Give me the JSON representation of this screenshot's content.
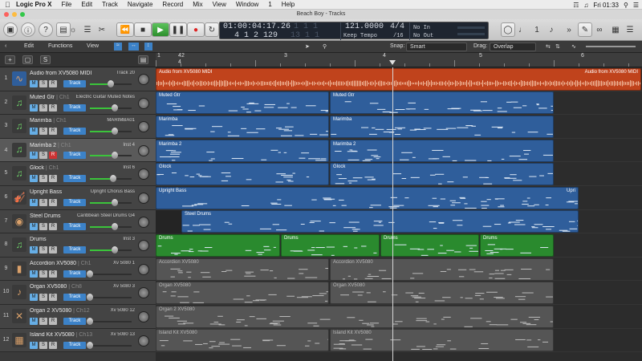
{
  "menubar": {
    "items": [
      "Logic Pro X",
      "File",
      "Edit",
      "Track",
      "Navigate",
      "Record",
      "Mix",
      "View",
      "Window",
      "1",
      "Help"
    ],
    "clock": "Fri 01:33"
  },
  "window": {
    "title": "Beach Boy - Tracks"
  },
  "lcd": {
    "smpte": "01:00:04:17.26",
    "bars": "4  1  2  129",
    "smpte_dim": "1  1  1",
    "bars_dim": "13  1  1",
    "tempo": "121.0000",
    "tempo_mode": "Keep Tempo",
    "signature": "4/4",
    "division": "/16",
    "in": "No In",
    "out": "No Out"
  },
  "edit_toolbar": {
    "edit": "Edit",
    "functions": "Functions",
    "view": "View",
    "snap_label": "Snap:",
    "snap_value": "Smart",
    "drag_label": "Drag:",
    "drag_value": "Overlap"
  },
  "ruler": {
    "marks": [
      "1",
      "2",
      "3",
      "4",
      "5",
      "6"
    ],
    "sub": [
      "4",
      "4"
    ]
  },
  "track_button_label": "Track",
  "msr": {
    "m": "M",
    "s": "S",
    "r": "R"
  },
  "tracks": [
    {
      "num": "1",
      "name": "Audio from XV5080 MIDI",
      "ch": "",
      "plugin": "Track 20",
      "icon": "waveform-icon",
      "record": false,
      "fader": 0.5
    },
    {
      "num": "2",
      "name": "Muted Gtr",
      "ch": "| Ch1",
      "plugin": "Electric Guitar Muted Notes",
      "icon": "midi-note-icon",
      "record": false,
      "fader": 0.6
    },
    {
      "num": "3",
      "name": "Marimba",
      "ch": "| Ch1",
      "plugin": "MARIMBA01",
      "icon": "midi-note-icon",
      "record": false,
      "fader": 0.6
    },
    {
      "num": "4",
      "name": "Marimba 2",
      "ch": "| Ch1",
      "plugin": "Inst 4",
      "icon": "midi-note-icon",
      "record": true,
      "fader": 0.6
    },
    {
      "num": "5",
      "name": "Glock",
      "ch": "| Ch1",
      "plugin": "Inst 6",
      "icon": "midi-note-icon",
      "record": false,
      "fader": 0.55
    },
    {
      "num": "6",
      "name": "Upright Bass",
      "ch": "",
      "plugin": "Upright Chorus Bass",
      "icon": "upright-bass-icon",
      "record": false,
      "fader": 0.6
    },
    {
      "num": "7",
      "name": "Steel Drums",
      "ch": "",
      "plugin": "Caribbean Steel Drums G4",
      "icon": "steel-drum-icon",
      "record": false,
      "fader": 0.6
    },
    {
      "num": "8",
      "name": "Drums",
      "ch": "",
      "plugin": "Inst 3",
      "icon": "midi-note-icon",
      "record": false,
      "fader": 0.6
    },
    {
      "num": "9",
      "name": "Accordion XV5080",
      "ch": "| Ch1",
      "plugin": "Xv 5080 1",
      "icon": "accordion-icon",
      "record": false,
      "fader": 0.0
    },
    {
      "num": "10",
      "name": "Organ XV5080",
      "ch": "| Ch8",
      "plugin": "Xv 5080 3",
      "icon": "guitar-icon",
      "record": false,
      "fader": 0.0
    },
    {
      "num": "11",
      "name": "Organ 2 XV5080",
      "ch": "| Ch12",
      "plugin": "Xv 5080 12",
      "icon": "scissors-icon",
      "record": false,
      "fader": 0.0
    },
    {
      "num": "12",
      "name": "Island Kit XV5080",
      "ch": "| Ch13",
      "plugin": "Xv 5080 13",
      "icon": "piano-keys-icon",
      "record": false,
      "fader": 0.0
    }
  ],
  "regions": [
    [
      {
        "label": "Audio from XV5080 MIDI",
        "label_right": "Audio from XV5080 MIDI",
        "color": "red",
        "start": 0,
        "end": 606
      }
    ],
    [
      {
        "label": "Muted Gtr",
        "color": "blue",
        "start": 0,
        "end": 217
      },
      {
        "label": "Muted Gtr",
        "color": "blue",
        "start": 217,
        "end": 497
      }
    ],
    [
      {
        "label": "Marimba",
        "color": "blue",
        "start": 0,
        "end": 217
      },
      {
        "label": "Marimba",
        "color": "blue",
        "start": 217,
        "end": 497
      }
    ],
    [
      {
        "label": "Marimba 2",
        "color": "blue",
        "start": 0,
        "end": 217
      },
      {
        "label": "Marimba 2",
        "color": "blue",
        "start": 217,
        "end": 497
      }
    ],
    [
      {
        "label": "Glock",
        "color": "blue",
        "start": 0,
        "end": 217
      },
      {
        "label": "Glock",
        "color": "blue",
        "start": 217,
        "end": 497
      }
    ],
    [
      {
        "label": "Upright Bass",
        "label_right": "Upri",
        "color": "blue",
        "start": 0,
        "end": 528
      }
    ],
    [
      {
        "label": "Steel Drums",
        "color": "blue",
        "start": 32,
        "end": 528
      }
    ],
    [
      {
        "label": "Drums",
        "color": "green",
        "start": 0,
        "end": 156
      },
      {
        "label": "Drums",
        "color": "green",
        "start": 156,
        "end": 280
      },
      {
        "label": "Drums",
        "color": "green",
        "start": 280,
        "end": 404
      },
      {
        "label": "Drums",
        "color": "green",
        "start": 404,
        "end": 497
      }
    ],
    [
      {
        "label": "Accordion XV5080",
        "color": "gray",
        "start": 0,
        "end": 217
      },
      {
        "label": "Accordion XV5080",
        "color": "gray",
        "start": 217,
        "end": 497
      }
    ],
    [
      {
        "label": "Organ XV5080",
        "color": "gray",
        "start": 0,
        "end": 217
      },
      {
        "label": "Organ XV5080",
        "color": "gray",
        "start": 217,
        "end": 497
      }
    ],
    [
      {
        "label": "Organ 2 XV5080",
        "color": "gray",
        "start": 0,
        "end": 497
      }
    ],
    [
      {
        "label": "Island Kit XV5080",
        "color": "gray",
        "start": 0,
        "end": 217
      },
      {
        "label": "Island Kit XV5080",
        "color": "gray",
        "start": 217,
        "end": 497
      }
    ]
  ],
  "colors": {
    "region_blue": "#2f5e9b",
    "region_green": "#2a8a2e",
    "region_red": "#c0431c",
    "region_gray": "#555555"
  }
}
